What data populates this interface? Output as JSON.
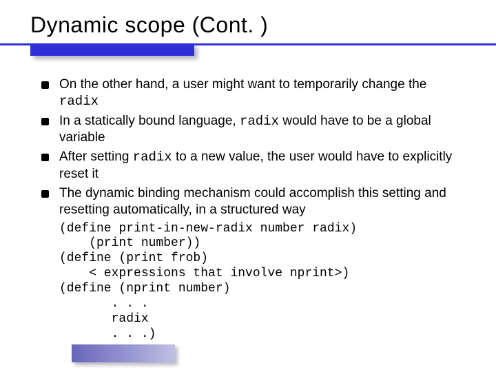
{
  "title": "Dynamic scope (Cont. )",
  "bullets": [
    {
      "pre": "On the other hand, a user might want to temporarily change the ",
      "code": "radix",
      "post": ""
    },
    {
      "pre": "In a statically bound language, ",
      "code": "radix",
      "post": " would have to be a global variable"
    },
    {
      "pre": "After setting ",
      "code": "radix",
      "post": " to a new value, the user would have to explicitly reset it"
    },
    {
      "pre": "The dynamic binding mechanism could accomplish this setting and resetting automatically, in a structured way",
      "code": "",
      "post": ""
    }
  ],
  "code": "(define print-in-new-radix number radix)\n    (print number))\n(define (print frob)\n    < expressions that involve nprint>)\n(define (nprint number)\n       . . .\n       radix\n       . . .)"
}
